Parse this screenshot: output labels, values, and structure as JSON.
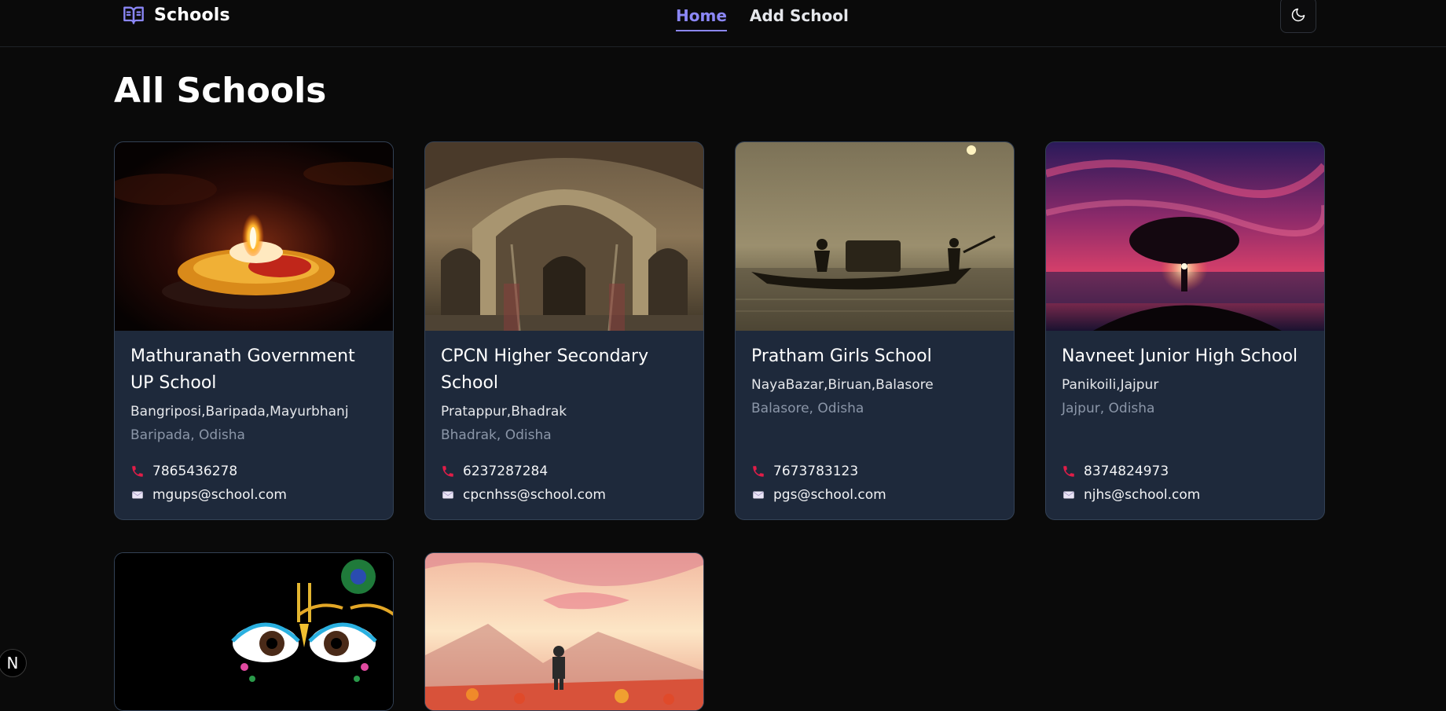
{
  "header": {
    "brand": "Schools",
    "nav": [
      {
        "label": "Home",
        "active": true
      },
      {
        "label": "Add School",
        "active": false
      }
    ],
    "theme_toggle_icon": "moon-icon"
  },
  "page_title": "All Schools",
  "schools": [
    {
      "name": "Mathuranath Government UP School",
      "address": "Bangriposi,Baripada,Mayurbhanj",
      "city_state": "Baripada, Odisha",
      "phone": "7865436278",
      "email": "mgups@school.com",
      "image": "diya-lamp-photo"
    },
    {
      "name": "CPCN Higher Secondary School",
      "address": "Pratappur,Bhadrak",
      "city_state": "Bhadrak, Odisha",
      "phone": "6237287284",
      "email": "cpcnhss@school.com",
      "image": "ancient-arch-interior-photo"
    },
    {
      "name": "Pratham Girls School",
      "address": "NayaBazar,Biruan,Balasore",
      "city_state": "Balasore, Odisha",
      "phone": "7673783123",
      "email": "pgs@school.com",
      "image": "boat-on-river-sunset-photo"
    },
    {
      "name": "Navneet Junior High School",
      "address": "Panikoili,Jajpur",
      "city_state": "Jajpur, Odisha",
      "phone": "8374824973",
      "email": "njhs@school.com",
      "image": "lone-tree-pink-sky-photo"
    },
    {
      "image": "krishna-eyes-art"
    },
    {
      "image": "wanderer-anime-landscape"
    }
  ],
  "colors": {
    "accent": "#8b87f7",
    "card_bg": "#1e293b",
    "page_bg": "#0a0a0a",
    "phone_icon": "#e11d48"
  },
  "badge": "N"
}
